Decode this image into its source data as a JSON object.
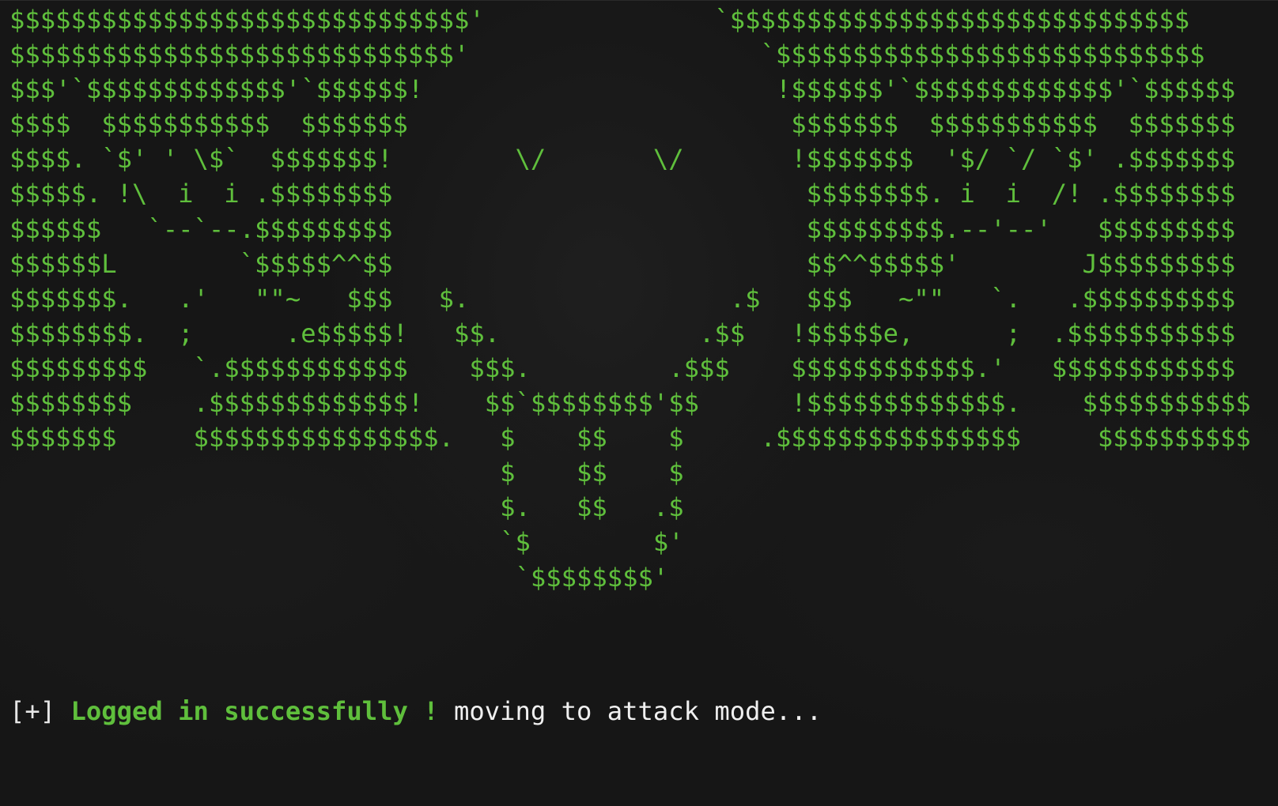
{
  "terminal": {
    "ascii_art": "$$$$$$$$$$$$$$$$$$$$$$$$$$$$$$'               `$$$$$$$$$$$$$$$$$$$$$$$$$$$$$$\n$$$$$$$$$$$$$$$$$$$$$$$$$$$$$'                   `$$$$$$$$$$$$$$$$$$$$$$$$$$$$\n$$$'`$$$$$$$$$$$$$'`$$$$$$!                       !$$$$$$'`$$$$$$$$$$$$$'`$$$$$$\n$$$$  $$$$$$$$$$$  $$$$$$$                         $$$$$$$  $$$$$$$$$$$  $$$$$$$\n$$$$. `$' ' \\$`  $$$$$$$!        \\/       \\/       !$$$$$$$  '$/ `/ `$' .$$$$$$$\n$$$$$. !\\  i  i .$$$$$$$$                           $$$$$$$$. i  i  /! .$$$$$$$$\n$$$$$$   `--`--.$$$$$$$$$                           $$$$$$$$$.--'--'   $$$$$$$$$\n$$$$$$L        `$$$$$^^$$                           $$^^$$$$$'        J$$$$$$$$$\n$$$$$$$.   .'   \"\"~   $$$   $.                 .$   $$$   ~\"\"   `.   .$$$$$$$$$$\n$$$$$$$$.  ;      .e$$$$$!   $$.             .$$   !$$$$$e,      ;  .$$$$$$$$$$$\n$$$$$$$$$   `.$$$$$$$$$$$$    $$$.         .$$$    $$$$$$$$$$$$.'   $$$$$$$$$$$$\n$$$$$$$$    .$$$$$$$$$$$$$!    $$`$$$$$$$$'$$      !$$$$$$$$$$$$$.    $$$$$$$$$$$\n$$$$$$$     $$$$$$$$$$$$$$$$.   $    $$    $     .$$$$$$$$$$$$$$$$     $$$$$$$$$$\n                                $    $$    $\n                                $.   $$   .$\n                                `$        $'\n                                 `$$$$$$$$'",
    "status": {
      "prefix": "[+] ",
      "success": "Logged in successfully !",
      "message": " moving to attack mode..."
    }
  },
  "colors": {
    "background": "#161616",
    "ascii_green": "#5fbf3c",
    "text_white": "#f0f0f0"
  }
}
